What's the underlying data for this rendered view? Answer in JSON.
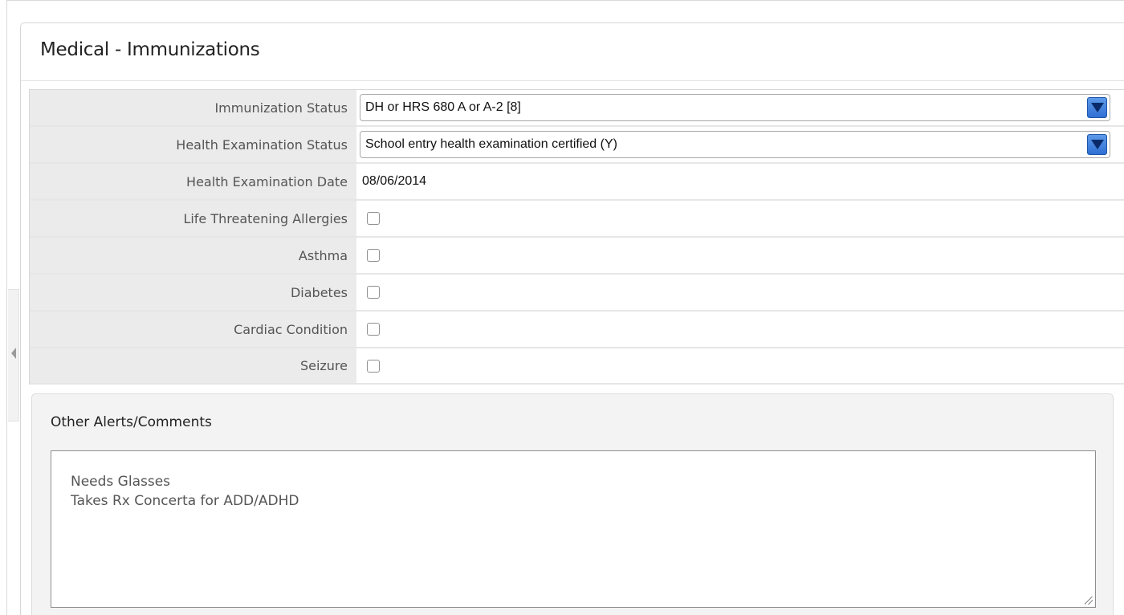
{
  "panel": {
    "title": "Medical - Immunizations"
  },
  "fields": {
    "immunization_status": {
      "label": "Immunization Status",
      "value": "DH or HRS 680 A or A-2 [8]"
    },
    "health_exam_status": {
      "label": "Health Examination Status",
      "value": "School entry health examination certified (Y)"
    },
    "health_exam_date": {
      "label": "Health Examination Date",
      "value": "08/06/2014"
    },
    "life_threatening_allergies": {
      "label": "Life Threatening Allergies",
      "checked": false
    },
    "asthma": {
      "label": "Asthma",
      "checked": false
    },
    "diabetes": {
      "label": "Diabetes",
      "checked": false
    },
    "cardiac_condition": {
      "label": "Cardiac Condition",
      "checked": false
    },
    "seizure": {
      "label": "Seizure",
      "checked": false
    }
  },
  "alerts": {
    "title": "Other Alerts/Comments",
    "lines": [
      "Needs Glasses",
      "Takes Rx Concerta for ADD/ADHD"
    ]
  },
  "colors": {
    "select_arrow": "#2f6fd3",
    "label_bg": "#ebebeb",
    "alerts_bg": "#f3f3f3"
  }
}
